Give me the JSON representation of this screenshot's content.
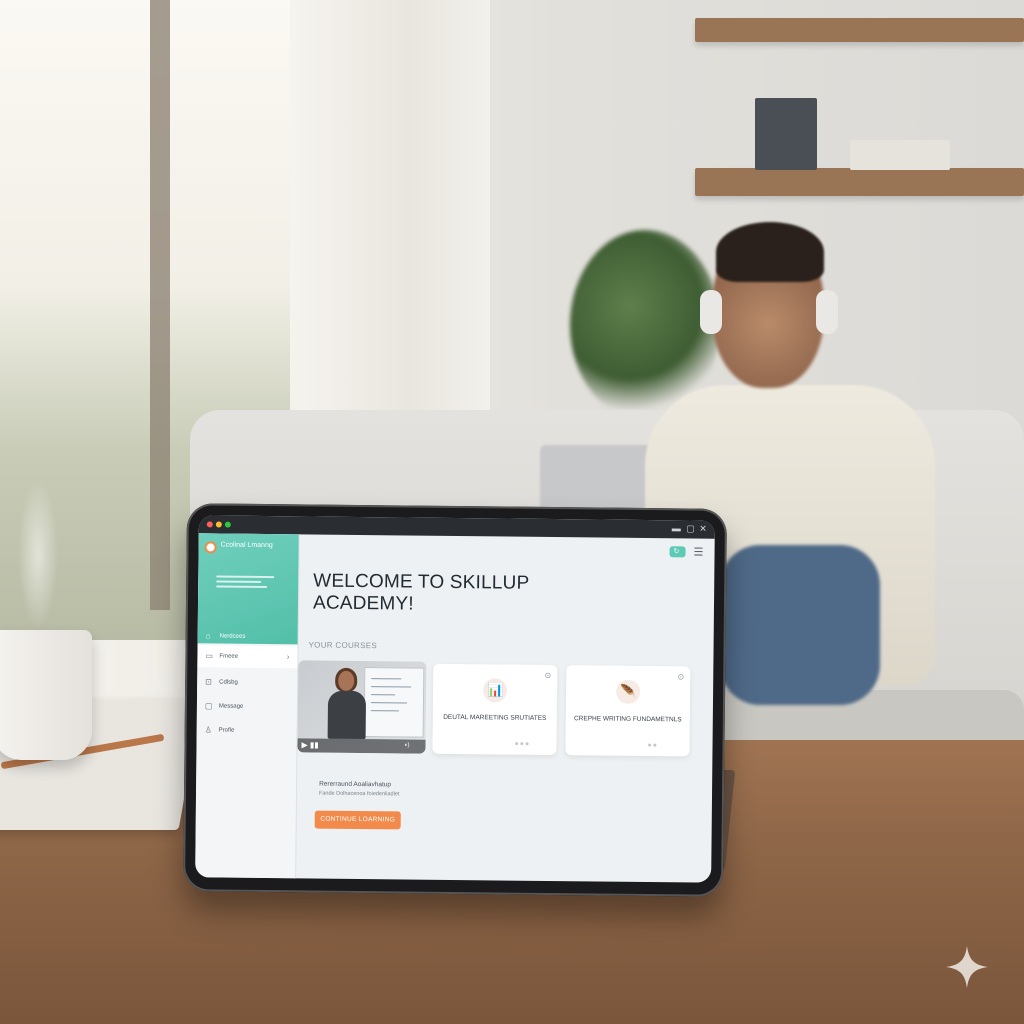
{
  "window": {
    "controls": [
      "▬",
      "▢",
      "✕"
    ]
  },
  "sidebar": {
    "brand_name": "Ccolinal Lmanng",
    "items": [
      {
        "label": "Nerdcees",
        "icon": "home-icon"
      },
      {
        "label": "Fmeee",
        "icon": "courses-icon"
      },
      {
        "label": "Cdlsbg",
        "icon": "catalog-icon"
      },
      {
        "label": "Message",
        "icon": "messages-icon"
      },
      {
        "label": "Profle",
        "icon": "profile-icon"
      }
    ]
  },
  "header": {
    "welcome_title": "WELCOME TO SKILLUP ACADEMY!",
    "top_button_icon": "↻"
  },
  "courses": {
    "section_label": "YOUR COURSES",
    "cards": [
      {
        "title": "DEUTAL MAREETING SRUTIATES",
        "icon": "chart-icon"
      },
      {
        "title": "CREPHE WRITING FUNDAMETNLS",
        "icon": "quill-icon"
      }
    ]
  },
  "progress": {
    "label": "Rererraund Aoaliavhatup",
    "sub": "Fande Dolhacenoa foiedenliadlet"
  },
  "cta": {
    "label": "CONTINUE LOARNING"
  },
  "colors": {
    "accent_teal": "#5ccab4",
    "accent_orange": "#f28a4b"
  }
}
